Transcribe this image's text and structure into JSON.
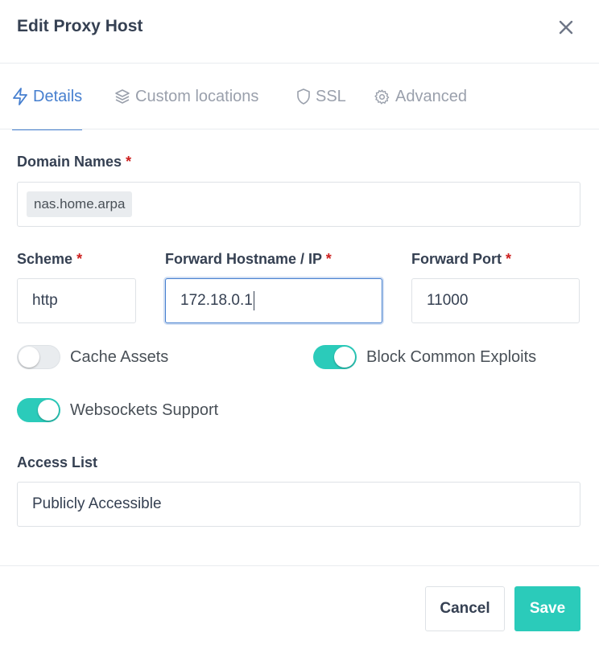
{
  "modal": {
    "title": "Edit Proxy Host"
  },
  "tabs": [
    {
      "label": "Details",
      "icon": "bolt-icon",
      "active": true
    },
    {
      "label": "Custom locations",
      "icon": "layers-icon"
    },
    {
      "label": "SSL",
      "icon": "shield-icon"
    },
    {
      "label": "Advanced",
      "icon": "gear-icon"
    }
  ],
  "form": {
    "required_mark": "*",
    "domain_names": {
      "label": "Domain Names",
      "values": [
        "nas.home.arpa"
      ]
    },
    "scheme": {
      "label": "Scheme",
      "value": "http"
    },
    "forward_host": {
      "label": "Forward Hostname / IP",
      "value": "172.18.0.1"
    },
    "forward_port": {
      "label": "Forward Port",
      "value": "11000"
    },
    "toggles": {
      "cache_assets": {
        "label": "Cache Assets",
        "checked": false
      },
      "block_exploits": {
        "label": "Block Common Exploits",
        "checked": true
      },
      "websockets": {
        "label": "Websockets Support",
        "checked": true
      }
    },
    "access_list": {
      "label": "Access List",
      "value": "Publicly Accessible"
    }
  },
  "footer": {
    "cancel_label": "Cancel",
    "save_label": "Save"
  },
  "colors": {
    "accent": "#467fcf",
    "toggle_on": "#2bcbba",
    "required": "#cd201f",
    "text": "#354052",
    "muted": "#9aa0ac"
  }
}
